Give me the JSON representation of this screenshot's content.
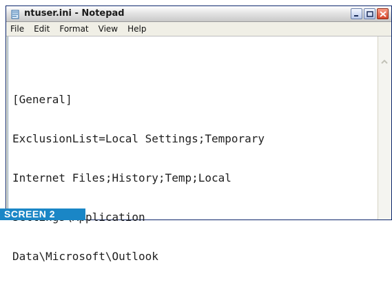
{
  "window": {
    "title": "ntuser.ini - Notepad"
  },
  "menu": [
    "File",
    "Edit",
    "Format",
    "View",
    "Help"
  ],
  "editor": {
    "lines": [
      "[General]",
      "ExclusionList=Local Settings;Temporary",
      "Internet Files;History;Temp;Local",
      "Settings\\Application",
      "Data\\Microsoft\\Outlook"
    ]
  },
  "caption": "SCREEN 2",
  "colors": {
    "caption_bg": "#1a86c6",
    "close_button": "#d6452a"
  },
  "icons": [
    "notepad-icon",
    "minimize-icon",
    "maximize-icon",
    "close-icon",
    "scroll-up-arrow-icon"
  ]
}
